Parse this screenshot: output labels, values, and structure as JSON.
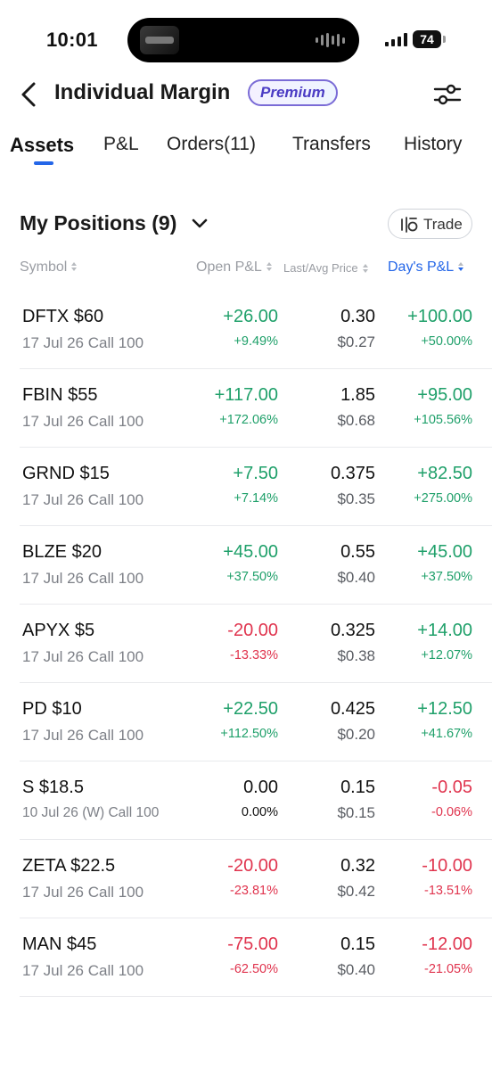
{
  "status_bar": {
    "time": "10:01",
    "battery": "74"
  },
  "header": {
    "title": "Individual Margin",
    "badge": "Premium"
  },
  "tabs": [
    {
      "label": "Assets",
      "active": true
    },
    {
      "label": "P&L",
      "active": false
    },
    {
      "label": "Orders(11)",
      "active": false
    },
    {
      "label": "Transfers",
      "active": false
    },
    {
      "label": "History",
      "active": false
    }
  ],
  "section": {
    "title": "My Positions (9)",
    "trade_label": "Trade"
  },
  "columns": {
    "symbol": "Symbol",
    "open_pl": "Open P&L",
    "last_avg": "Last/Avg Price",
    "days_pl": "Day's P&L"
  },
  "colors": {
    "positive": "#1fa06a",
    "negative": "#e0344e",
    "accent": "#2466e8"
  },
  "positions": [
    {
      "symbol": "DFTX $60",
      "contract": "17 Jul 26 Call 100",
      "open_pl": "+26.00",
      "open_pl_pct": "+9.49%",
      "open_dir": "pos",
      "last": "0.30",
      "avg": "$0.27",
      "day_pl": "+100.00",
      "day_pl_pct": "+50.00%",
      "day_dir": "pos"
    },
    {
      "symbol": "FBIN $55",
      "contract": "17 Jul 26 Call 100",
      "open_pl": "+117.00",
      "open_pl_pct": "+172.06%",
      "open_dir": "pos",
      "last": "1.85",
      "avg": "$0.68",
      "day_pl": "+95.00",
      "day_pl_pct": "+105.56%",
      "day_dir": "pos"
    },
    {
      "symbol": "GRND $15",
      "contract": "17 Jul 26 Call 100",
      "open_pl": "+7.50",
      "open_pl_pct": "+7.14%",
      "open_dir": "pos",
      "last": "0.375",
      "avg": "$0.35",
      "day_pl": "+82.50",
      "day_pl_pct": "+275.00%",
      "day_dir": "pos"
    },
    {
      "symbol": "BLZE $20",
      "contract": "17 Jul 26 Call 100",
      "open_pl": "+45.00",
      "open_pl_pct": "+37.50%",
      "open_dir": "pos",
      "last": "0.55",
      "avg": "$0.40",
      "day_pl": "+45.00",
      "day_pl_pct": "+37.50%",
      "day_dir": "pos"
    },
    {
      "symbol": "APYX $5",
      "contract": "17 Jul 26 Call 100",
      "open_pl": "-20.00",
      "open_pl_pct": "-13.33%",
      "open_dir": "neg",
      "last": "0.325",
      "avg": "$0.38",
      "day_pl": "+14.00",
      "day_pl_pct": "+12.07%",
      "day_dir": "pos"
    },
    {
      "symbol": "PD $10",
      "contract": "17 Jul 26 Call 100",
      "open_pl": "+22.50",
      "open_pl_pct": "+112.50%",
      "open_dir": "pos",
      "last": "0.425",
      "avg": "$0.20",
      "day_pl": "+12.50",
      "day_pl_pct": "+41.67%",
      "day_dir": "pos"
    },
    {
      "symbol": "S $18.5",
      "contract": "10 Jul 26 (W) Call 100",
      "open_pl": "0.00",
      "open_pl_pct": "0.00%",
      "open_dir": "neu",
      "last": "0.15",
      "avg": "$0.15",
      "day_pl": "-0.05",
      "day_pl_pct": "-0.06%",
      "day_dir": "neg"
    },
    {
      "symbol": "ZETA $22.5",
      "contract": "17 Jul 26 Call 100",
      "open_pl": "-20.00",
      "open_pl_pct": "-23.81%",
      "open_dir": "neg",
      "last": "0.32",
      "avg": "$0.42",
      "day_pl": "-10.00",
      "day_pl_pct": "-13.51%",
      "day_dir": "neg"
    },
    {
      "symbol": "MAN $45",
      "contract": "17 Jul 26 Call 100",
      "open_pl": "-75.00",
      "open_pl_pct": "-62.50%",
      "open_dir": "neg",
      "last": "0.15",
      "avg": "$0.40",
      "day_pl": "-12.00",
      "day_pl_pct": "-21.05%",
      "day_dir": "neg"
    }
  ]
}
